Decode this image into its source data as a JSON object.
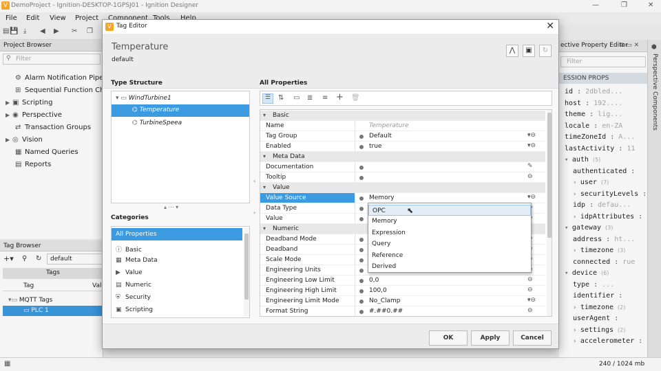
{
  "app": {
    "title": "DemoProject - Ignition-DESKTOP-1GPSJ01 - Ignition Designer",
    "menu": [
      "File",
      "Edit",
      "View",
      "Project",
      "Component",
      "Tools",
      "Help"
    ]
  },
  "project_browser": {
    "title": "Project Browser",
    "filter_placeholder": "Filter",
    "items": [
      {
        "label": "Alarm Notification Pipelines",
        "icon": "pipeline-icon"
      },
      {
        "label": "Sequential Function Charts",
        "icon": "sfc-icon"
      },
      {
        "label": "Scripting",
        "icon": "scripting-icon"
      },
      {
        "label": "Perspective",
        "icon": "perspective-icon"
      },
      {
        "label": "Transaction Groups",
        "icon": "transaction-icon"
      },
      {
        "label": "Vision",
        "icon": "vision-icon"
      },
      {
        "label": "Named Queries",
        "icon": "query-icon"
      },
      {
        "label": "Reports",
        "icon": "report-icon"
      }
    ]
  },
  "tag_browser": {
    "title": "Tag Browser",
    "provider": "default",
    "tab": "Tags",
    "columns": [
      "Tag",
      "Val"
    ],
    "rows": [
      "MQTT Tags",
      "PLC 1"
    ]
  },
  "property_editor": {
    "title": "ective Property Editor",
    "filter_placeholder": "Filter",
    "section": "ESSION PROPS",
    "side_tab": "Perspective Components",
    "rows": [
      {
        "key": "id",
        "value": "2dbled..."
      },
      {
        "key": "host",
        "value": "192...."
      },
      {
        "key": "theme",
        "value": "lig..."
      },
      {
        "key": "locale",
        "value": "en-ZA"
      },
      {
        "key": "timeZoneId",
        "value": "A..."
      },
      {
        "key": "lastActivity",
        "value": "11"
      },
      {
        "key": "auth",
        "value": "(5)"
      },
      {
        "key": "authenticated",
        "value": ""
      },
      {
        "key": "user",
        "value": "(7)"
      },
      {
        "key": "securityLevels",
        "value": "[2]"
      },
      {
        "key": "idp",
        "value": "defau..."
      },
      {
        "key": "idpAttributes",
        "value": "{0}"
      },
      {
        "key": "gateway",
        "value": "(3)"
      },
      {
        "key": "address",
        "value": "ht..."
      },
      {
        "key": "timezone",
        "value": "(3)"
      },
      {
        "key": "connected",
        "value": "rue"
      },
      {
        "key": "device",
        "value": "(6)"
      },
      {
        "key": "type",
        "value": "..."
      },
      {
        "key": "identifier",
        "value": ""
      },
      {
        "key": "timezone",
        "value": "(2)"
      },
      {
        "key": "userAgent",
        "value": ""
      },
      {
        "key": "settings",
        "value": "(2)"
      },
      {
        "key": "accelerometer",
        "value": ""
      }
    ]
  },
  "status": {
    "memory": "240 / 1024 mb"
  },
  "dialog": {
    "title": "Tag Editor",
    "tag_name": "Temperature",
    "provider": "default",
    "type_structure": {
      "title": "Type Structure",
      "root": "WindTurbine1",
      "children": [
        "Temperature",
        "TurbineSpeea"
      ]
    },
    "categories": {
      "title": "Categories",
      "items": [
        "All Properties",
        "Basic",
        "Meta Data",
        "Value",
        "Numeric",
        "Security",
        "Scripting"
      ]
    },
    "all_properties": {
      "title": "All Properties",
      "rows": [
        {
          "kind": "cat",
          "name": "Basic"
        },
        {
          "name": "Name",
          "value": "Temperature",
          "placeholder": true
        },
        {
          "name": "Tag Group",
          "value": "Default",
          "actions": "▾⊖"
        },
        {
          "name": "Enabled",
          "value": "true",
          "actions": "▾⊖"
        },
        {
          "kind": "cat",
          "name": "Meta Data"
        },
        {
          "name": "Documentation",
          "value": "",
          "actions": "✎"
        },
        {
          "name": "Tooltip",
          "value": "",
          "actions": "⊖"
        },
        {
          "kind": "cat",
          "name": "Value"
        },
        {
          "name": "Value Source",
          "value": "Memory",
          "actions": "▾⊖",
          "selected": true
        },
        {
          "name": "Data Type",
          "value": "",
          "actions": "⊖"
        },
        {
          "name": "Value",
          "value": "",
          "actions": "⊖"
        },
        {
          "kind": "cat",
          "name": "Numeric"
        },
        {
          "name": "Deadband Mode",
          "value": "",
          "actions": "⊖"
        },
        {
          "name": "Deadband",
          "value": "",
          "actions": "⊖"
        },
        {
          "name": "Scale Mode",
          "value": "",
          "actions": "⊖"
        },
        {
          "name": "Engineering Units",
          "value": "",
          "actions": "⊖"
        },
        {
          "name": "Engineering Low Limit",
          "value": "0,0",
          "actions": "⊖"
        },
        {
          "name": "Engineering High Limit",
          "value": "100,0",
          "actions": "⊖"
        },
        {
          "name": "Engineering Limit Mode",
          "value": "No_Clamp",
          "actions": "▾⊖"
        },
        {
          "name": "Format String",
          "value": "#.##0.##",
          "actions": "⊖"
        }
      ]
    },
    "dropdown_options": [
      "OPC",
      "Memory",
      "Expression",
      "Query",
      "Reference",
      "Derived"
    ],
    "buttons": {
      "ok": "OK",
      "apply": "Apply",
      "cancel": "Cancel"
    }
  }
}
